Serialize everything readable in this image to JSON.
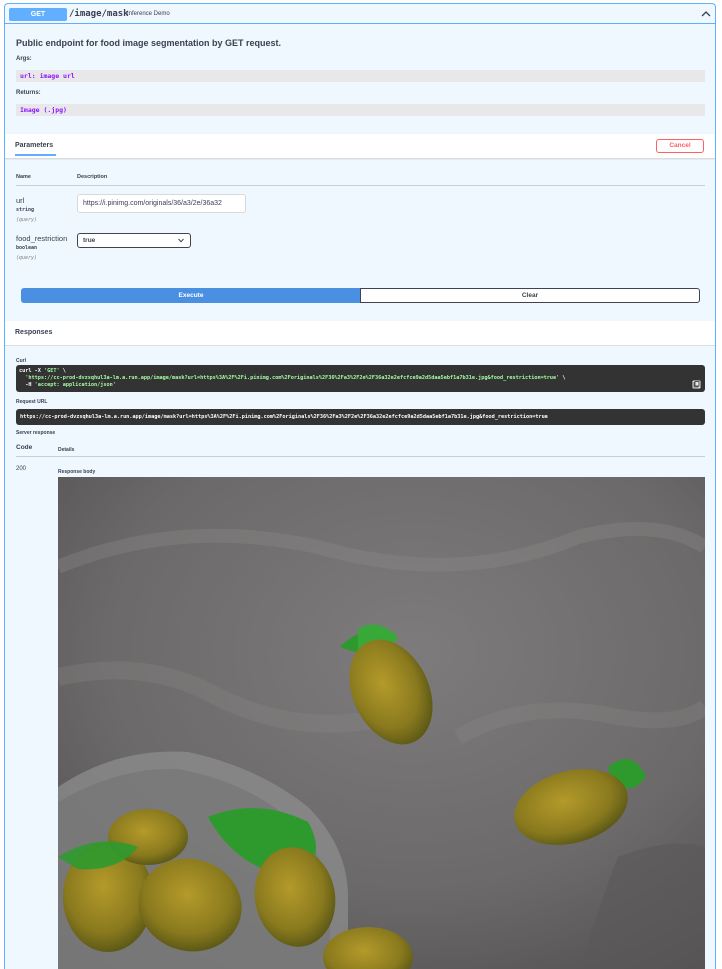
{
  "operation": {
    "method": "GET",
    "path": "/image/mask",
    "summary": "Inference Demo",
    "description": "Public endpoint for food image segmentation by GET request.",
    "args_label": "Args:",
    "args_value": "url: image url",
    "returns_label": "Returns:",
    "returns_value": "Image (.jpg)"
  },
  "parameters": {
    "tab_label": "Parameters",
    "cancel_label": "Cancel",
    "col_name": "Name",
    "col_description": "Description",
    "items": [
      {
        "name": "url",
        "type": "string",
        "in": "(query)",
        "value": "https://i.pinimg.com/originals/36/a3/2e/36a32"
      },
      {
        "name": "food_restriction",
        "type": "boolean",
        "in": "(query)",
        "value": "true"
      }
    ],
    "execute_label": "Execute",
    "clear_label": "Clear"
  },
  "responses": {
    "title": "Responses",
    "curl_label": "Curl",
    "curl_line1_cmd": "curl -X ",
    "curl_line1_method": "'GET'",
    "curl_line1_tail": " \\",
    "curl_line2_url": "  'https://cc-prod-dvzsqhul3a-lm.a.run.app/image/mask?url=https%3A%2F%2Fi.pinimg.com%2Foriginals%2F36%2Fa3%2F2e%2F36a32e2efcfce9a2d5daa5ebf1a7b31e.jpg&food_restriction=true'",
    "curl_line2_tail": " \\",
    "curl_line3_flag": "  -H ",
    "curl_line3_header": "'accept: application/json'",
    "request_url_label": "Request URL",
    "request_url": "https://cc-prod-dvzsqhul3a-lm.a.run.app/image/mask?url=https%3A%2F%2Fi.pinimg.com%2Foriginals%2F36%2Fa3%2F2e%2F36a32e2efcfce9a2d5daa5ebf1a7b31e.jpg&food_restriction=true",
    "server_response_label": "Server response",
    "col_code": "Code",
    "col_details": "Details",
    "status_code": "200",
    "response_body_label": "Response body"
  },
  "colors": {
    "get_blue": "#61affe",
    "execute_blue": "#4990e2",
    "cancel_red": "#ff6060",
    "mask_green": "#2e9a2e"
  }
}
